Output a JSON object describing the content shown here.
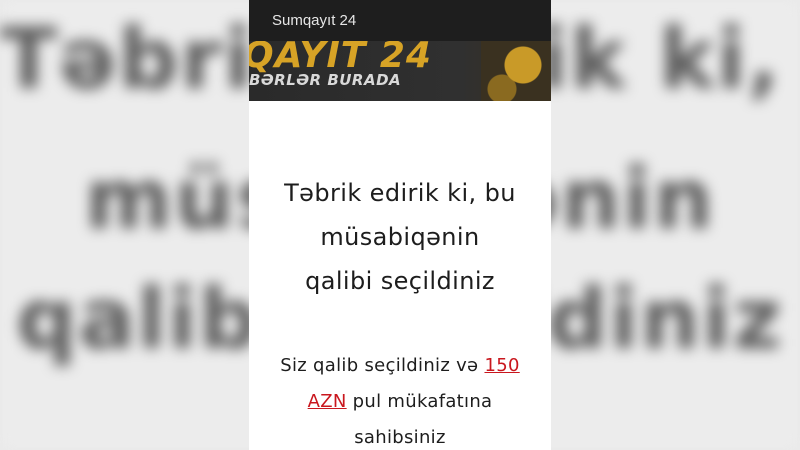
{
  "header": {
    "title": "Sumqayıt 24"
  },
  "banner": {
    "brand_text": "QAYIT 24",
    "tagline": "BƏRLƏR BURADA"
  },
  "main": {
    "headline_lines": [
      "Təbrik edirik ki, bu",
      "müsabiqənin",
      "qalibi seçildiniz"
    ],
    "message_prefix": "Siz qalib seçildiniz və",
    "prize_amount_line1": "150",
    "prize_amount_line2": "AZN",
    "message_suffix": "pul mükafatına",
    "message_end": "sahibsiniz"
  },
  "colors": {
    "link": "#c9171e",
    "topbar_bg": "#1e1e1e",
    "brand": "#d7a326"
  }
}
